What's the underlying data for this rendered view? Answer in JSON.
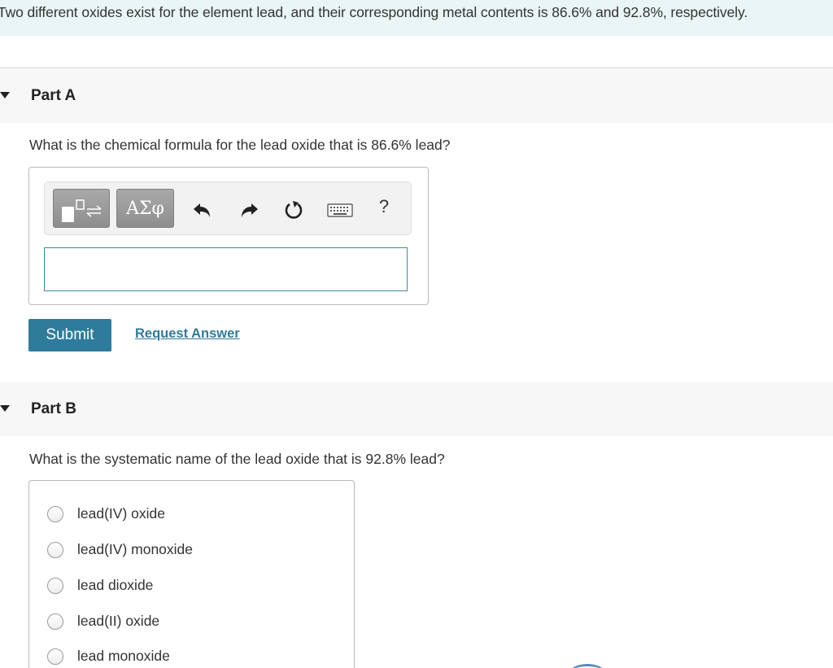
{
  "intro": {
    "text": "Two different oxides exist for the element lead, and their corresponding metal contents is 86.6% and 92.8%, respectively."
  },
  "part_a": {
    "title": "Part A",
    "question": "What is the chemical formula for the lead oxide that is 86.6% lead?",
    "toolbar": {
      "templates_icon": "templates-icon",
      "symbols_label": "ΑΣφ",
      "undo_icon": "undo-icon",
      "redo_icon": "redo-icon",
      "reset_icon": "reset-icon",
      "keyboard_icon": "keyboard-icon",
      "help_label": "?"
    },
    "answer_value": "",
    "submit_label": "Submit",
    "request_answer_label": "Request Answer"
  },
  "part_b": {
    "title": "Part B",
    "question": "What is the systematic name of the lead oxide that is 92.8% lead?",
    "options": [
      "lead(IV) oxide",
      "lead(IV) monoxide",
      "lead dioxide",
      "lead(II) oxide",
      "lead monoxide"
    ],
    "selected_option": null
  },
  "colors": {
    "accent": "#2f7b9b",
    "intro_bg": "#eaf6f6",
    "header_bg": "#f7f7f7"
  }
}
